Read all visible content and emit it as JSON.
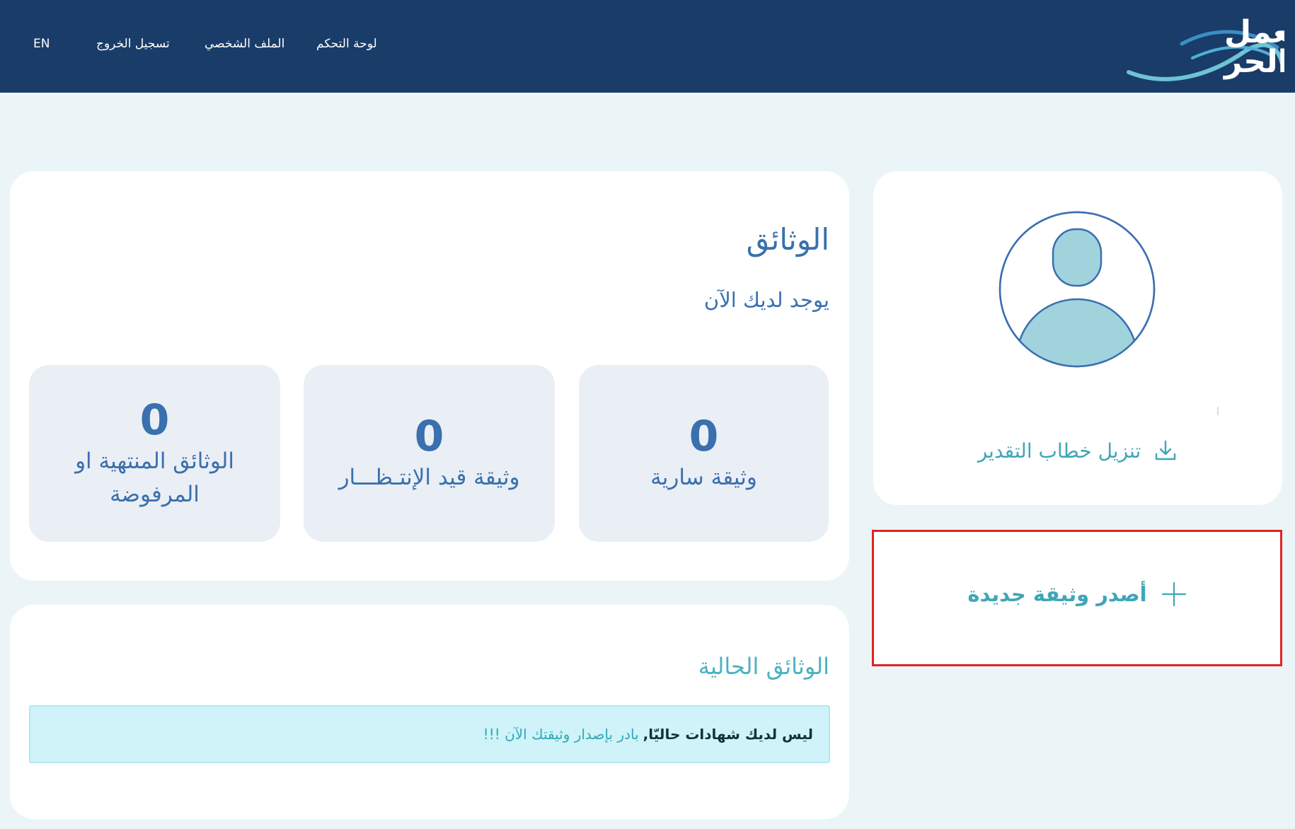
{
  "nav": {
    "dashboard": "لوحة التحكم",
    "profile": "الملف الشخصي",
    "logout": "تسجيل الخروج",
    "language": "EN"
  },
  "logo": {
    "line1": "العمل",
    "line2": "الحر"
  },
  "documents": {
    "title": "الوثائق",
    "subtitle": "يوجد لديك الآن",
    "stats": [
      {
        "value": "0",
        "label": "وثيقة سارية"
      },
      {
        "value": "0",
        "label": "وثيقة قيد الإنتـظـــار"
      },
      {
        "value": "0",
        "label": "الوثائق المنتهية او المرفوضة"
      }
    ]
  },
  "current": {
    "title": "الوثائق الحالية",
    "alert_strong": "ليس لديك شهادات حاليّا,",
    "alert_link": "بادر بإصدار وثيقتك الآن !!!"
  },
  "profile": {
    "download_label": "تنزيل خطاب التقدير",
    "avatar_icon": "user-avatar-icon",
    "download_icon": "download-icon"
  },
  "new_document": {
    "label": "أصدر وثيقة جديدة",
    "icon": "plus-icon"
  },
  "colors": {
    "navbar": "#1a3c69",
    "page_bg": "#ebf5f8",
    "primary_text": "#3970ad",
    "accent_teal": "#3fa6b6",
    "stat_bg": "#eaeef5",
    "alert_bg": "#cff3f9",
    "highlight_border": "#e32222"
  }
}
